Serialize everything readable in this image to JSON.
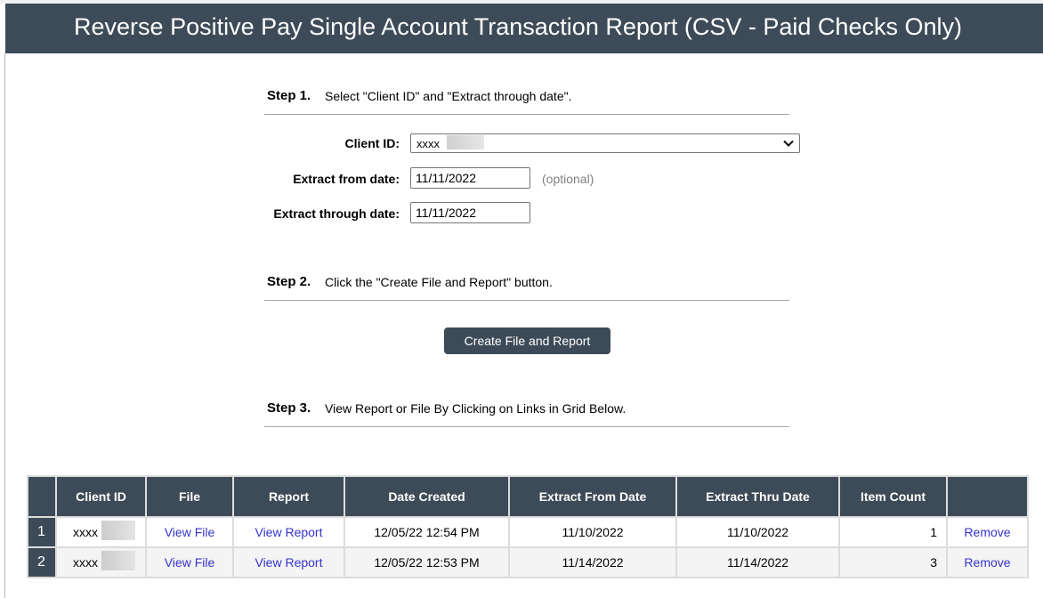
{
  "header": {
    "title": "Reverse Positive Pay Single Account Transaction Report (CSV - Paid Checks Only)"
  },
  "step1": {
    "num": "Step 1.",
    "text": "Select \"Client ID\" and \"Extract through date\".",
    "client_id_label": "Client ID:",
    "client_id_value": "xxxx",
    "extract_from_label": "Extract from date:",
    "extract_from_value": "11/11/2022",
    "optional_hint": "(optional)",
    "extract_through_label": "Extract through date:",
    "extract_through_value": "11/11/2022"
  },
  "step2": {
    "num": "Step 2.",
    "text": "Click the \"Create File and Report\" button.",
    "button_label": "Create File and Report"
  },
  "step3": {
    "num": "Step 3.",
    "text": "View Report or File By Clicking on Links in Grid Below."
  },
  "grid": {
    "columns": [
      "",
      "Client ID",
      "File",
      "Report",
      "Date Created",
      "Extract From Date",
      "Extract Thru Date",
      "Item Count",
      ""
    ],
    "rows": [
      {
        "num": "1",
        "client_id": "xxxx",
        "file": "View File",
        "report": "View Report",
        "date_created": "12/05/22 12:54 PM",
        "extract_from": "11/10/2022",
        "extract_thru": "11/10/2022",
        "item_count": "1",
        "action": "Remove"
      },
      {
        "num": "2",
        "client_id": "xxxx",
        "file": "View File",
        "report": "View Report",
        "date_created": "12/05/22 12:53 PM",
        "extract_from": "11/14/2022",
        "extract_thru": "11/14/2022",
        "item_count": "3",
        "action": "Remove"
      }
    ]
  },
  "colors": {
    "header_bg": "#3d4b58",
    "link": "#3333cc"
  }
}
